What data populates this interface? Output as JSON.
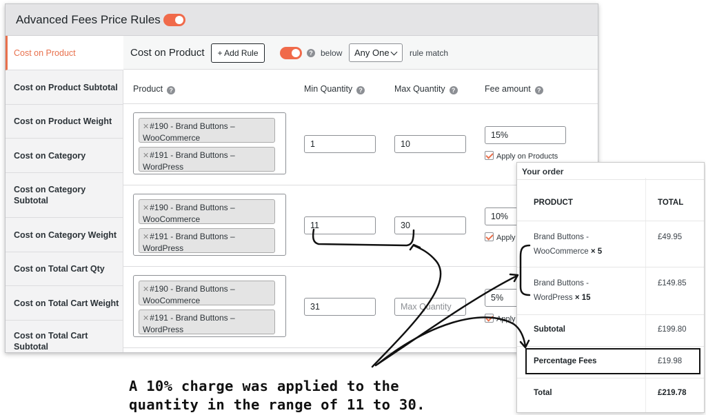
{
  "header": {
    "title": "Advanced Fees Price Rules",
    "enabled": true
  },
  "sidebar": {
    "items": [
      {
        "label": "Cost on Product",
        "active": true
      },
      {
        "label": "Cost on Product Subtotal"
      },
      {
        "label": "Cost on Product Weight"
      },
      {
        "label": "Cost on Category"
      },
      {
        "label": "Cost on Category Subtotal"
      },
      {
        "label": "Cost on Category Weight"
      },
      {
        "label": "Cost on Total Cart Qty"
      },
      {
        "label": "Cost on Total Cart Weight"
      },
      {
        "label": "Cost on Total Cart Subtotal"
      }
    ]
  },
  "toolbar": {
    "title": "Cost on Product",
    "add_rule_label": "+ Add Rule",
    "toggle_enabled": true,
    "below_label": "below",
    "match_select": "Any One",
    "match_label": "rule match"
  },
  "columns": {
    "product": "Product",
    "min": "Min Quantity",
    "max": "Max Quantity",
    "fee": "Fee amount"
  },
  "rules": [
    {
      "products": [
        "#190 - Brand Buttons – WooCommerce",
        "#191 - Brand Buttons – WordPress"
      ],
      "min": "1",
      "max": "10",
      "fee": "15%",
      "apply_label": "Apply on Products"
    },
    {
      "products": [
        "#190 - Brand Buttons – WooCommerce",
        "#191 - Brand Buttons – WordPress"
      ],
      "min": "11",
      "max": "30",
      "fee": "10%",
      "apply_label": "Apply"
    },
    {
      "products": [
        "#190 - Brand Buttons – WooCommerce",
        "#191 - Brand Buttons – WordPress"
      ],
      "min": "31",
      "max_placeholder": "Max Quantity",
      "fee": "5%",
      "apply_label": "Apply"
    }
  ],
  "order": {
    "title": "Your order",
    "product_header": "PRODUCT",
    "total_header": "TOTAL",
    "items": [
      {
        "name_line1": "Brand Buttons -",
        "name_line2": "WooCommerce",
        "qty": "× 5",
        "total": "£49.95"
      },
      {
        "name_line1": "Brand Buttons -",
        "name_line2": "WordPress",
        "qty": "× 15",
        "total": "£149.85"
      }
    ],
    "subtotal_label": "Subtotal",
    "subtotal": "£199.80",
    "fees_label": "Percentage Fees",
    "fees": "£19.98",
    "total_label": "Total",
    "total": "£219.78"
  },
  "caption": {
    "line1": "A 10% charge was applied to the",
    "line2": "quantity in the range of 11 to 30."
  },
  "colors": {
    "accent": "#e8704c",
    "toggle": "#f06a4a",
    "delete": "#d63638"
  },
  "icons": [
    "help-icon",
    "trash-icon",
    "chevron-down-icon",
    "remove-x-icon",
    "checkbox-checked-icon"
  ]
}
